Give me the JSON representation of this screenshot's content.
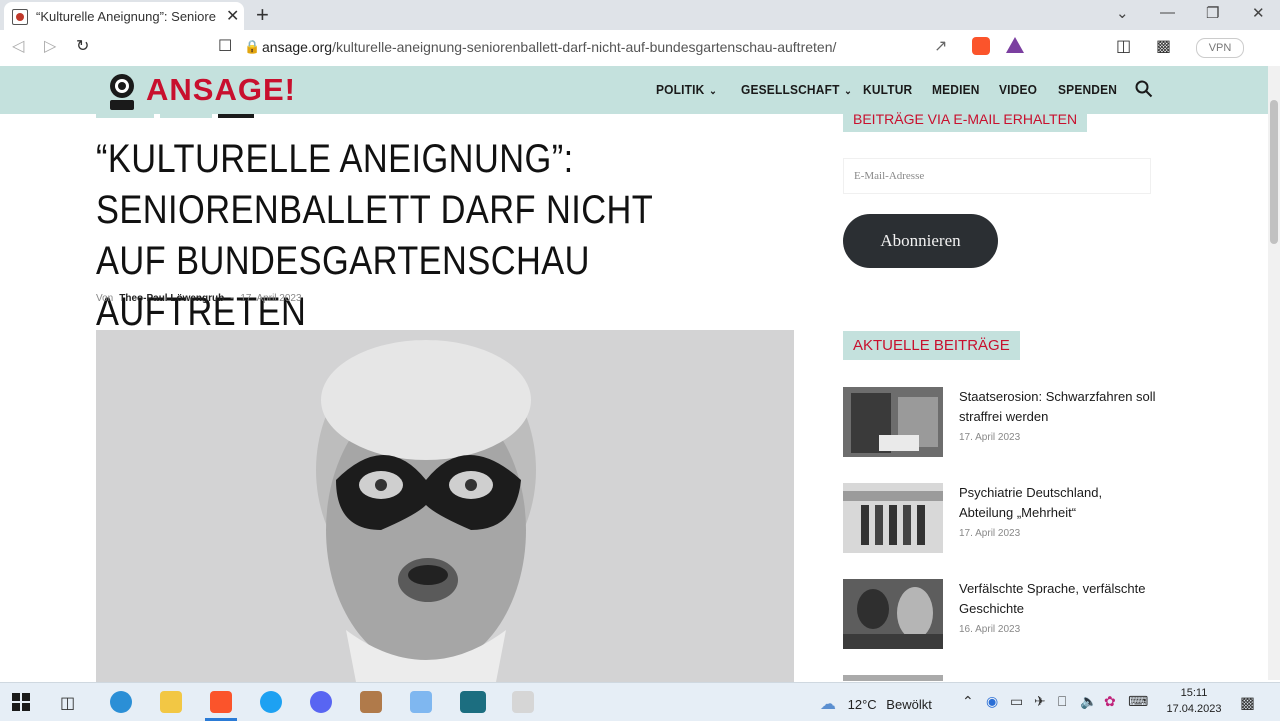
{
  "browser": {
    "tab_title": "“Kulturelle Aneignung”: Senioren",
    "url_host": "ansage.org",
    "url_path": "/kulturelle-aneignung-seniorenballett-darf-nicht-auf-bundesgartenschau-auftreten/",
    "vpn_label": "VPN",
    "controls": {
      "minimize": "—",
      "restore": "❐",
      "close": "✕",
      "dropdown": "⌄",
      "new_tab": "+"
    }
  },
  "site": {
    "logo_text": "ANSAGE!",
    "brand_color": "#c8102e",
    "header_color": "#c4e1dd",
    "menu": [
      {
        "label": "POLITIK",
        "has_dropdown": true
      },
      {
        "label": "GESELLSCHAFT",
        "has_dropdown": true
      },
      {
        "label": "KULTUR",
        "has_dropdown": false
      },
      {
        "label": "MEDIEN",
        "has_dropdown": false
      },
      {
        "label": "VIDEO",
        "has_dropdown": false
      },
      {
        "label": "SPENDEN",
        "has_dropdown": false
      }
    ]
  },
  "article": {
    "headline": "“KULTURELLE ANEIGNUNG”: SENIORENBALLETT DARF NICHT AUF BUNDESGARTENSCHAU AUFTRETEN",
    "byline_prefix": "Von",
    "author": "Theo-Paul Löwengrub",
    "date": "17. April 2023",
    "separator": "-"
  },
  "sidebar": {
    "email_heading": "BEITRÄGE VIA E-MAIL ERHALTEN",
    "email_placeholder": "E-Mail-Adresse",
    "subscribe_label": "Abonnieren",
    "recent_heading": "AKTUELLE BEITRÄGE",
    "posts": [
      {
        "title": "Staatserosion: Schwarzfahren soll straffrei werden",
        "date": "17. April 2023"
      },
      {
        "title": "Psychiatrie Deutschland, Abteilung „Mehrheit“",
        "date": "17. April 2023"
      },
      {
        "title": "Verfälschte Sprache, verfälschte Geschichte",
        "date": "16. April 2023"
      }
    ]
  },
  "taskbar": {
    "weather_temp": "12°C",
    "weather_text": "Bewölkt",
    "time": "15:11",
    "date": "17.04.2023"
  }
}
